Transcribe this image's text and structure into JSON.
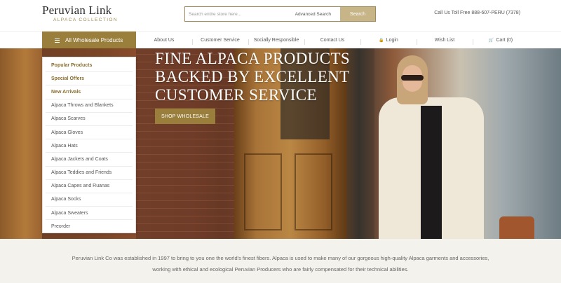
{
  "logo": {
    "name": "Peruvian Link",
    "tagline": "ALPACA COLLECTION"
  },
  "search": {
    "placeholder": "Search entire store here...",
    "advanced_label": "Advanced Search",
    "button_label": "Search"
  },
  "phone": "Call Us Toll Free 888-607-PERU (7378)",
  "nav": {
    "all_products_label": "All Wholesale Products",
    "items": [
      {
        "label": "About Us",
        "icon": ""
      },
      {
        "label": "Customer Service",
        "icon": ""
      },
      {
        "label": "Socially Responsible",
        "icon": ""
      },
      {
        "label": "Contact Us",
        "icon": ""
      },
      {
        "label": "Login",
        "icon": "lock-icon"
      },
      {
        "label": "Wish List",
        "icon": ""
      },
      {
        "label": "Cart (0)",
        "icon": "cart-icon"
      }
    ]
  },
  "dropdown": {
    "items": [
      {
        "label": "Popular Products",
        "bold": true
      },
      {
        "label": "Special Offers",
        "bold": true
      },
      {
        "label": "New Arrivals",
        "bold": true
      },
      {
        "label": "Alpaca Throws and Blankets",
        "bold": false
      },
      {
        "label": "Alpaca Scarves",
        "bold": false
      },
      {
        "label": "Alpaca Gloves",
        "bold": false
      },
      {
        "label": "Alpaca Hats",
        "bold": false
      },
      {
        "label": "Alpaca Jackets and Coats",
        "bold": false
      },
      {
        "label": "Alpaca Teddies and Friends",
        "bold": false
      },
      {
        "label": "Alpaca Capes and Ruanas",
        "bold": false
      },
      {
        "label": "Alpaca Socks",
        "bold": false
      },
      {
        "label": "Alpaca Sweaters",
        "bold": false
      },
      {
        "label": "Preorder",
        "bold": false
      }
    ]
  },
  "hero": {
    "title_lines": [
      "FINE ALPACA PRODUCTS",
      "BACKED BY EXCELLENT",
      "CUSTOMER SERVICE"
    ],
    "button_label": "SHOP WHOLESALE"
  },
  "about": {
    "text": "Peruvian Link Co was established in 1997 to bring to you one the world's finest fibers. Alpaca is used to make many of our gorgeous high-quality Alpaca garments and accessories, working with ethical and ecological Peruvian Producers who are fairly compensated for their technical abilities."
  },
  "colors": {
    "accent": "#9a7f3c",
    "search_button": "#c7b587",
    "about_bg": "#f4f2ec"
  }
}
